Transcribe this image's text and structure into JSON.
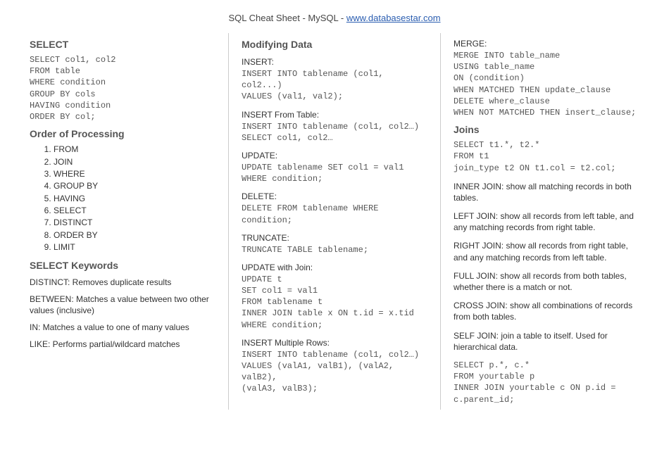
{
  "title_prefix": "SQL Cheat Sheet - MySQL - ",
  "title_link_text": "www.databasestar.com",
  "col1": {
    "select_h": "SELECT",
    "select_code": "SELECT col1, col2\nFROM table\nWHERE condition\nGROUP BY cols\nHAVING condition\nORDER BY col;",
    "order_h": "Order of Processing",
    "order_items": [
      "FROM",
      "JOIN",
      "WHERE",
      "GROUP BY",
      "HAVING",
      "SELECT",
      "DISTINCT",
      "ORDER BY",
      "LIMIT"
    ],
    "keywords_h": "SELECT Keywords",
    "keywords": [
      "DISTINCT: Removes duplicate results",
      "BETWEEN: Matches a value between two other values (inclusive)",
      "IN: Matches a value to one of many values",
      "LIKE: Performs partial/wildcard matches"
    ]
  },
  "col2": {
    "mod_h": "Modifying Data",
    "insert_h": "INSERT:",
    "insert_code": "INSERT INTO tablename (col1, col2...)\nVALUES (val1, val2);",
    "insertfrom_h": "INSERT From Table:",
    "insertfrom_code": "INSERT INTO tablename (col1, col2…)\nSELECT col1, col2…",
    "update_h": "UPDATE:",
    "update_code": "UPDATE tablename SET col1 = val1\nWHERE condition;",
    "delete_h": "DELETE:",
    "delete_code": "DELETE FROM tablename WHERE condition;",
    "truncate_h": "TRUNCATE:",
    "truncate_code": "TRUNCATE TABLE tablename;",
    "updatejoin_h": "UPDATE with Join:",
    "updatejoin_code": "UPDATE t\nSET col1 = val1\nFROM tablename t\nINNER JOIN table x ON t.id = x.tid\nWHERE condition;",
    "insertmulti_h": "INSERT Multiple Rows:",
    "insertmulti_code": "INSERT INTO tablename (col1, col2…)\nVALUES (valA1, valB1), (valA2, valB2),\n(valA3, valB3);"
  },
  "col3": {
    "merge_h": "MERGE:",
    "merge_code": "MERGE INTO table_name\nUSING table_name\nON (condition)\nWHEN MATCHED THEN update_clause\nDELETE where_clause\nWHEN NOT MATCHED THEN insert_clause;",
    "joins_h": "Joins",
    "joins_code": "SELECT t1.*, t2.*\nFROM t1\njoin_type t2 ON t1.col = t2.col;",
    "join_descs": [
      "INNER JOIN: show all matching records in both tables.",
      "LEFT JOIN: show all records from left table, and any matching records from right table.",
      "RIGHT JOIN: show all records from right table, and any matching records from left table.",
      "FULL JOIN: show all records from both tables, whether there is a match or not.",
      "CROSS JOIN: show all combinations of records from both tables."
    ],
    "selfjoin_desc": "SELF JOIN: join a table to itself. Used for hierarchical data.",
    "selfjoin_code": "SELECT p.*, c.*\nFROM yourtable p\nINNER JOIN yourtable c ON p.id = c.parent_id;"
  }
}
